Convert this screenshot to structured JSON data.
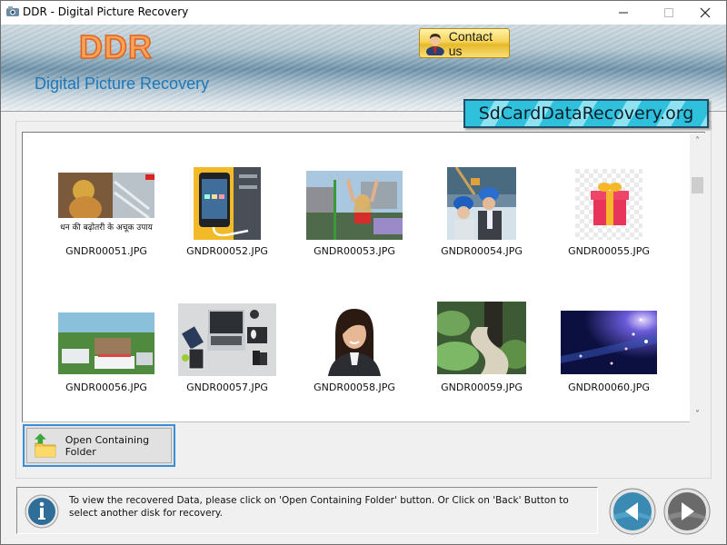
{
  "window": {
    "title": "DDR - Digital Picture Recovery",
    "controls": {
      "minimize": "—",
      "maximize": "☐",
      "close": "✕"
    }
  },
  "header": {
    "logo_text": "DDR",
    "subtitle": "Digital Picture Recovery",
    "contact_button": "Contact us",
    "site_badge": "SdCardDataRecovery.org"
  },
  "gallery": {
    "files": [
      {
        "name": "GNDR00051.JPG",
        "thumb": "ganesh-banner"
      },
      {
        "name": "GNDR00052.JPG",
        "thumb": "phone-charging"
      },
      {
        "name": "GNDR00053.JPG",
        "thumb": "woman-festival"
      },
      {
        "name": "GNDR00054.JPG",
        "thumb": "engineers-hardhats"
      },
      {
        "name": "GNDR00055.JPG",
        "thumb": "gift-box"
      },
      {
        "name": "GNDR00056.JPG",
        "thumb": "campus-aerial"
      },
      {
        "name": "GNDR00057.JPG",
        "thumb": "desk-laptop"
      },
      {
        "name": "GNDR00058.JPG",
        "thumb": "woman-portrait"
      },
      {
        "name": "GNDR00059.JPG",
        "thumb": "forest-path"
      },
      {
        "name": "GNDR00060.JPG",
        "thumb": "blue-bokeh"
      }
    ],
    "scroll": {
      "up": "˄",
      "down": "˅"
    }
  },
  "actions": {
    "open_folder": "Open Containing Folder"
  },
  "info": {
    "message": "To view the recovered Data, please click on 'Open Containing Folder' button. Or Click on 'Back' Button to select another disk for recovery."
  },
  "colors": {
    "accent_blue": "#3c8fd6",
    "subtitle_blue": "#1e78b8",
    "logo_orange": "#f6a25a",
    "badge_cyan": "#2fc1dc"
  }
}
